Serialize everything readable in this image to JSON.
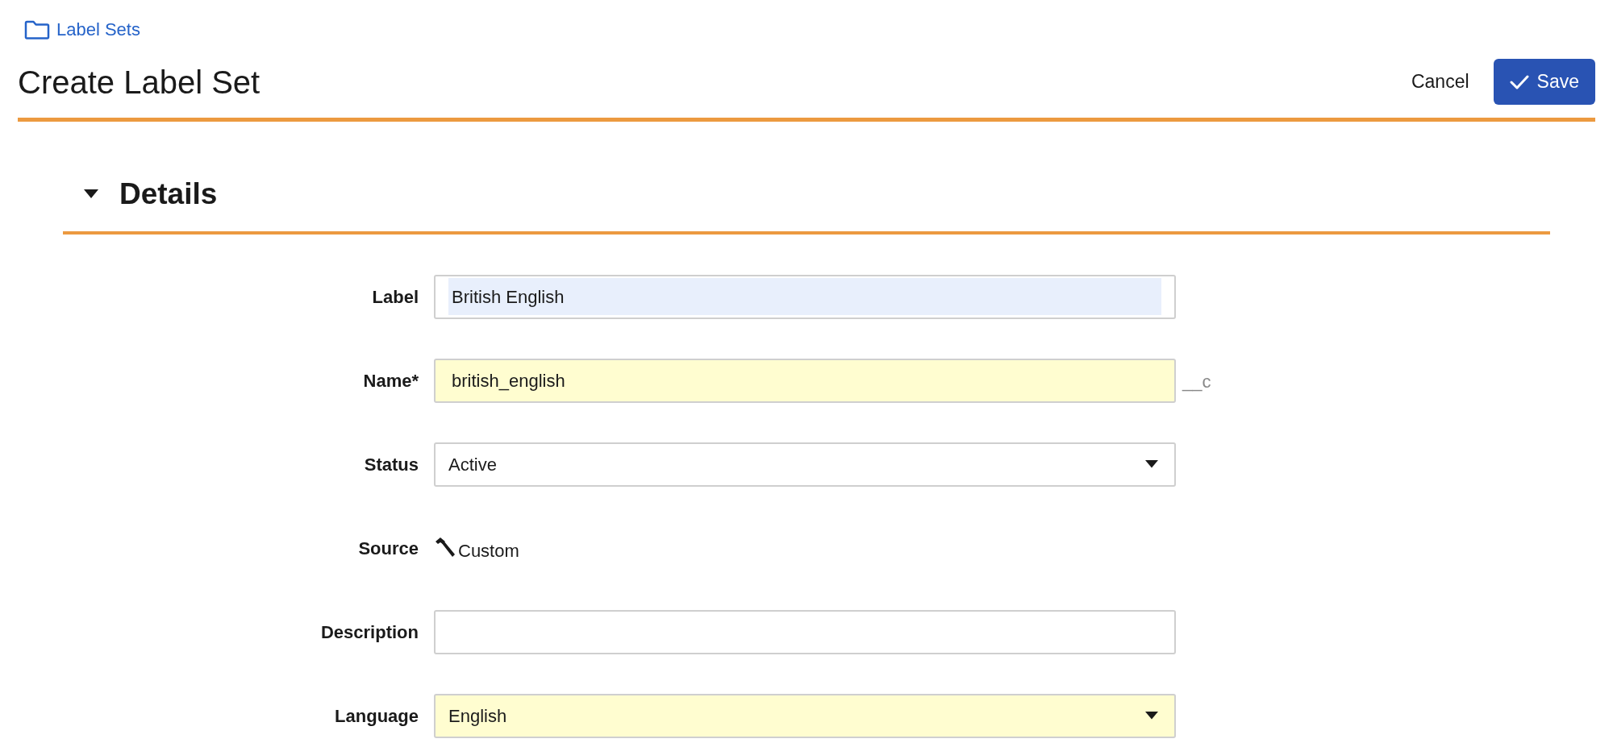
{
  "breadcrumb": {
    "label": "Label Sets"
  },
  "header": {
    "title": "Create Label Set",
    "cancel": "Cancel",
    "save": "Save"
  },
  "section": {
    "title": "Details",
    "expanded": true
  },
  "fields": [
    {
      "kind": "text",
      "label": "Label",
      "value": "British English",
      "required": false,
      "text_selected": true
    },
    {
      "kind": "text",
      "label": "Name*",
      "value": "british_english",
      "required": true,
      "text_selected": false,
      "suffix": "__c"
    },
    {
      "kind": "select",
      "label": "Status",
      "value": "Active",
      "required": false
    },
    {
      "kind": "readonly",
      "label": "Source",
      "value": "Custom"
    },
    {
      "kind": "text",
      "label": "Description",
      "required": false,
      "text_selected": false
    },
    {
      "kind": "select",
      "label": "Language",
      "value": "English",
      "required": true
    }
  ]
}
